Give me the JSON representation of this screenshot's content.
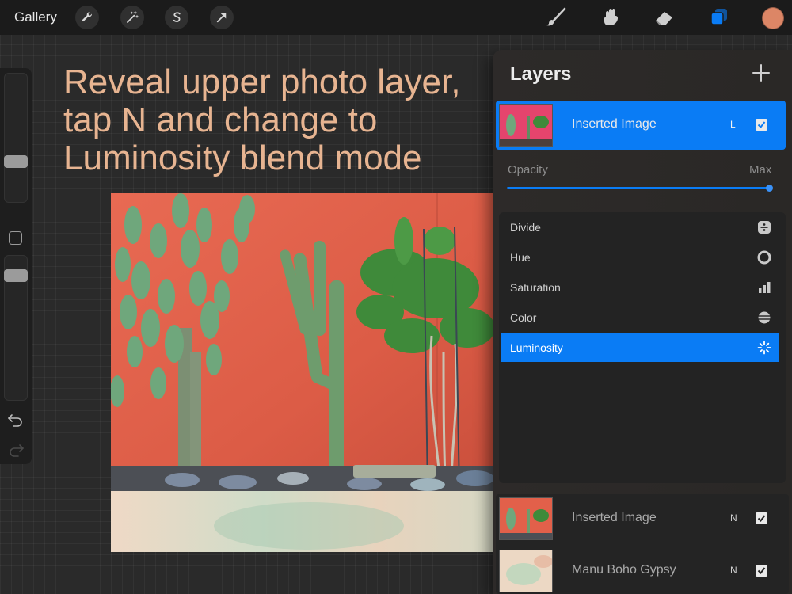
{
  "topbar": {
    "gallery_label": "Gallery",
    "tools": [
      {
        "icon": "wrench-icon"
      },
      {
        "icon": "magic-wand-icon"
      },
      {
        "icon": "selection-s-icon"
      },
      {
        "icon": "transform-arrow-icon"
      }
    ],
    "right_tools": [
      {
        "icon": "brush-icon"
      },
      {
        "icon": "smudge-icon"
      },
      {
        "icon": "eraser-icon"
      },
      {
        "icon": "layers-icon",
        "color": "#0a7cf5"
      }
    ],
    "current_color": "#dc8666"
  },
  "instruction": {
    "lines": [
      "Reveal upper photo layer,",
      "tap N and change to",
      "Luminosity blend mode"
    ]
  },
  "layers": {
    "title": "Layers",
    "add_icon": "plus-icon",
    "selected_layer": {
      "name": "Inserted Image",
      "blend_abbrev": "L",
      "visible": true
    },
    "opacity": {
      "label": "Opacity",
      "value_label": "Max",
      "fraction": 1.0
    },
    "blend_modes": [
      {
        "label": "Divide",
        "icon": "divide-icon",
        "selected": false
      },
      {
        "label": "Hue",
        "icon": "hue-icon",
        "selected": false
      },
      {
        "label": "Saturation",
        "icon": "saturation-icon",
        "selected": false
      },
      {
        "label": "Color",
        "icon": "color-icon",
        "selected": false
      },
      {
        "label": "Luminosity",
        "icon": "luminosity-icon",
        "selected": true
      }
    ],
    "other_layers": [
      {
        "name": "Inserted Image",
        "blend_abbrev": "N",
        "visible": true
      },
      {
        "name": "Manu Boho Gypsy",
        "blend_abbrev": "N",
        "visible": true
      }
    ]
  }
}
